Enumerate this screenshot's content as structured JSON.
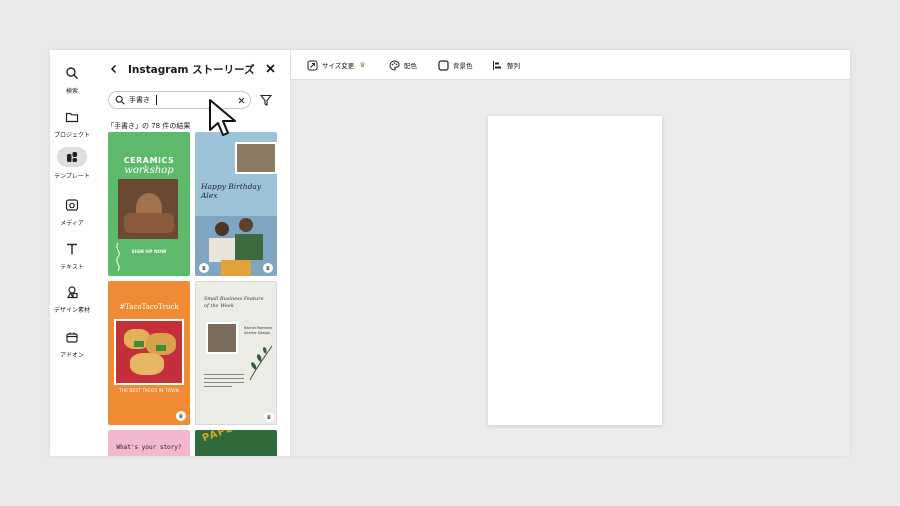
{
  "rail": {
    "items": [
      {
        "label": "検索",
        "icon": "search-icon"
      },
      {
        "label": "プロジェクト",
        "icon": "folder-icon"
      },
      {
        "label": "テンプレート",
        "icon": "templates-icon",
        "active": true
      },
      {
        "label": "メディア",
        "icon": "media-icon"
      },
      {
        "label": "テキスト",
        "icon": "text-icon"
      },
      {
        "label": "デザイン素材",
        "icon": "shapes-icon"
      },
      {
        "label": "アドオン",
        "icon": "addon-icon"
      }
    ]
  },
  "panel": {
    "title": "Instagram ストーリーズ",
    "search": {
      "value": "手書き",
      "placeholder": ""
    },
    "results": "「手書き」の 78 件の結果",
    "templates": [
      {
        "heading": "CERAMICS",
        "script": "workshop",
        "cta": "SIGN UP NOW",
        "bg": "#5dba6a"
      },
      {
        "script": "Happy Birthday Alex",
        "bg": "#9dc3d9"
      },
      {
        "heading": "#TacoTacoTruck",
        "script": "THE BEST TACOS IN TOWN",
        "bg": "#f08a33"
      },
      {
        "heading": "Small Business Feature of the Week",
        "name": "Rachel Martinez Interior Design",
        "bg": "#ecece7"
      },
      {
        "heading": "What's your story?",
        "bg": "#f2b8cf"
      },
      {
        "heading": "PAPER GREEN",
        "bg": "#2f6b3a"
      }
    ]
  },
  "toolbar": {
    "resize": "サイズ変更",
    "colors": "配色",
    "background": "背景色",
    "align": "整列"
  },
  "colors": {
    "accent": "#5dba6a",
    "rail_active": "#dedede"
  }
}
